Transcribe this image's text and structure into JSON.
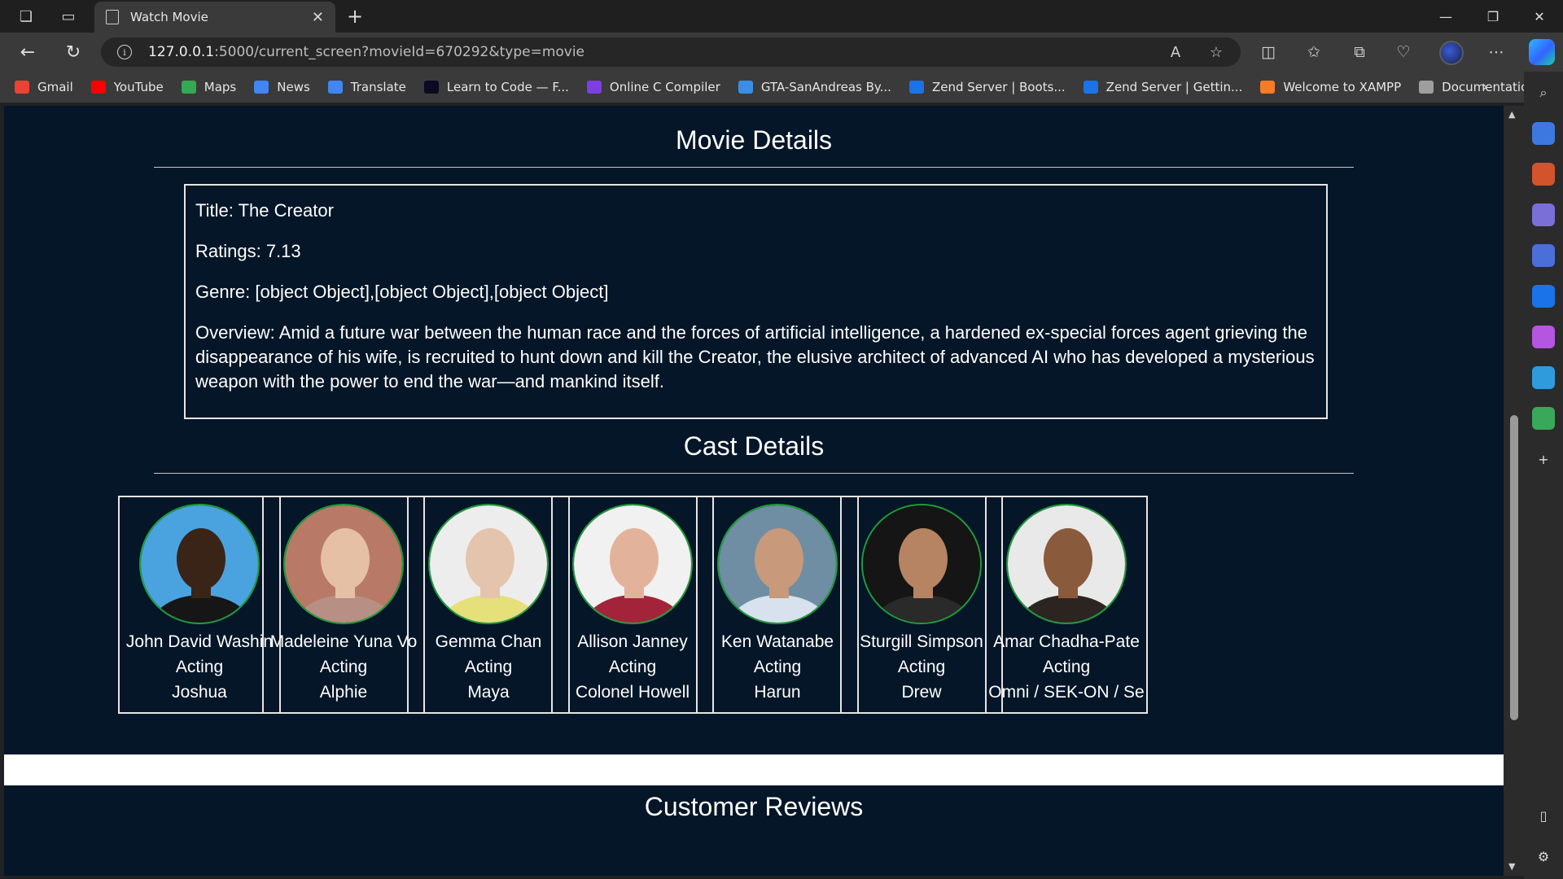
{
  "browser": {
    "tab_title": "Watch Movie",
    "url_host": "127.0.0.1",
    "url_rest": ":5000/current_screen?movieId=670292&type=movie",
    "bookmarks": [
      {
        "label": "Gmail",
        "color": "#ea4335"
      },
      {
        "label": "YouTube",
        "color": "#ff0000"
      },
      {
        "label": "Maps",
        "color": "#34a853"
      },
      {
        "label": "News",
        "color": "#4285f4"
      },
      {
        "label": "Translate",
        "color": "#4285f4"
      },
      {
        "label": "Learn to Code — F...",
        "color": "#0a0a23"
      },
      {
        "label": "Online C Compiler",
        "color": "#7b3fe4"
      },
      {
        "label": "GTA-SanAndreas By...",
        "color": "#3a8ee6"
      },
      {
        "label": "Zend Server | Boots...",
        "color": "#1a73e8"
      },
      {
        "label": "Zend Server | Gettin...",
        "color": "#1a73e8"
      },
      {
        "label": "Welcome to XAMPP",
        "color": "#fb7a24"
      },
      {
        "label": "Documentation for...",
        "color": "#9e9e9e"
      }
    ]
  },
  "movie": {
    "section_title": "Movie Details",
    "title_line": "Title: The Creator",
    "ratings_line": "Ratings: 7.13",
    "genre_line": "Genre: [object Object],[object Object],[object Object]",
    "overview_line": "Overview: Amid a future war between the human race and the forces of artificial intelligence, a hardened ex-special forces agent grieving the disappearance of his wife, is recruited to hunt down and kill the Creator, the elusive architect of advanced AI who has developed a mysterious weapon with the power to end the war—and mankind itself."
  },
  "cast": {
    "section_title": "Cast Details",
    "members": [
      {
        "name": "John David Washin",
        "department": "Acting",
        "character": "Joshua",
        "skin": "#3a2418",
        "bg": "#4aa3df",
        "shirt": "#161616"
      },
      {
        "name": "Madeleine Yuna Vo",
        "department": "Acting",
        "character": "Alphie",
        "skin": "#e5c0a5",
        "bg": "#b87a66",
        "shirt": "#b88f84"
      },
      {
        "name": "Gemma Chan",
        "department": "Acting",
        "character": "Maya",
        "skin": "#e4c4ad",
        "bg": "#ededed",
        "shirt": "#e6e07a"
      },
      {
        "name": "Allison Janney",
        "department": "Acting",
        "character": "Colonel Howell",
        "skin": "#e2b39a",
        "bg": "#f1f1f1",
        "shirt": "#a3243a"
      },
      {
        "name": "Ken Watanabe",
        "department": "Acting",
        "character": "Harun",
        "skin": "#c8997b",
        "bg": "#6f8da3",
        "shirt": "#d7e2ee"
      },
      {
        "name": "Sturgill Simpson",
        "department": "Acting",
        "character": "Drew",
        "skin": "#b68462",
        "bg": "#151515",
        "shirt": "#2a2a2a"
      },
      {
        "name": "Amar Chadha-Pate",
        "department": "Acting",
        "character": "Omni / SEK-ON / Se",
        "skin": "#8a5a3c",
        "bg": "#e9e9e9",
        "shirt": "#2c2420"
      }
    ]
  },
  "reviews": {
    "section_title": "Customer Reviews"
  }
}
